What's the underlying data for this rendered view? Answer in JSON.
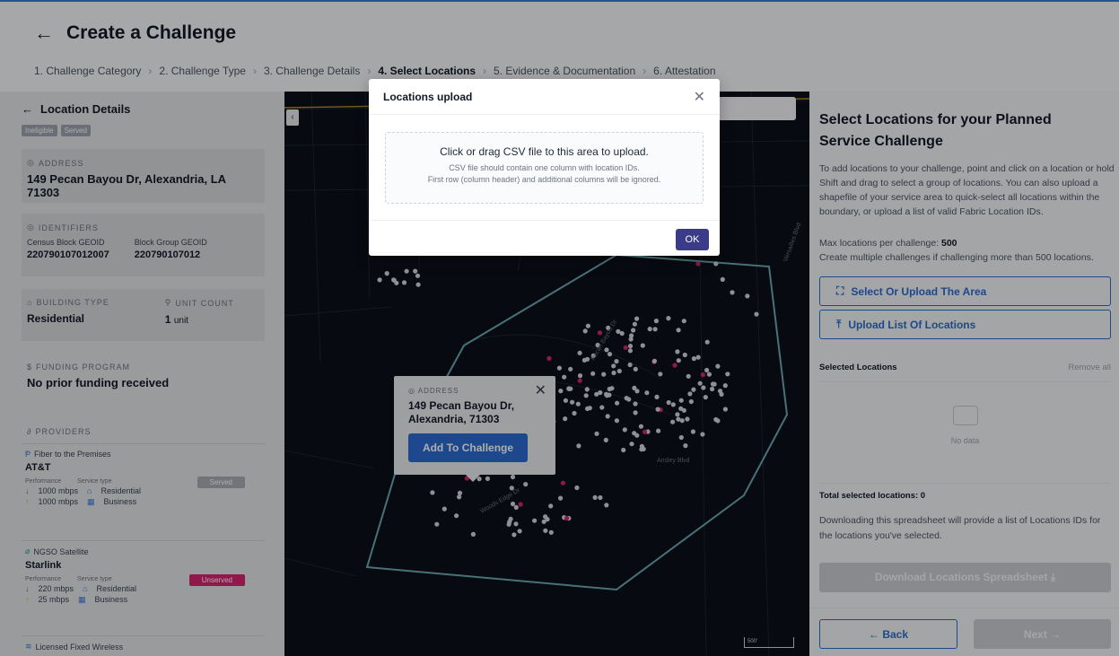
{
  "header": {
    "title": "Create a Challenge",
    "steps": [
      "1. Challenge Category",
      "2. Challenge Type",
      "3. Challenge Details",
      "4. Select Locations",
      "5. Evidence & Documentation",
      "6. Attestation"
    ],
    "active_step": 3
  },
  "left": {
    "title": "Location Details",
    "chips": [
      "Ineligible",
      "Served"
    ],
    "address_label": "ADDRESS",
    "address": "149 Pecan Bayou Dr, Alexandria, LA 71303",
    "identifiers_label": "IDENTIFIERS",
    "census_label": "Census Block GEOID",
    "census_value": "220790107012007",
    "group_label": "Block Group GEOID",
    "group_value": "220790107012",
    "building_label": "BUILDING TYPE",
    "building_value": "Residential",
    "unit_label": "UNIT COUNT",
    "unit_value": "1",
    "unit_suffix": "unit",
    "funding_label": "FUNDING PROGRAM",
    "funding_value": "No prior funding received",
    "providers_label": "PROVIDERS",
    "providers": [
      {
        "tech": "Fiber to the Premises",
        "name": "AT&T",
        "perf_label": "Performance",
        "service_label": "Service type",
        "status": "Served",
        "down": "1000 mbps",
        "up": "1000 mbps",
        "svc1": "Residential",
        "svc2": "Business"
      },
      {
        "tech": "NGSO Satellite",
        "name": "Starlink",
        "perf_label": "Performance",
        "service_label": "Service type",
        "status": "Unserved",
        "down": "220 mbps",
        "up": "25 mbps",
        "svc1": "Residential",
        "svc2": "Business"
      },
      {
        "tech": "Licensed Fixed Wireless"
      }
    ]
  },
  "map": {
    "popup_label": "ADDRESS",
    "popup_line1": "149 Pecan Bayou Dr,",
    "popup_line2": "Alexandria, 71303",
    "popup_button": "Add To Challenge",
    "scale_text": "500'",
    "street_labels": [
      "Ansley Blvd",
      "Woods Edge Dr",
      "Versailles Blvd",
      "Pecan Bayou Dr"
    ]
  },
  "right": {
    "title": "Select Locations for your Planned Service Challenge",
    "description": "To add locations to your challenge, point and click on a location or hold Shift and drag to select a group of locations. You can also upload a shapefile of your service area to quick-select all locations within the boundary, or upload a list of valid Fabric Location IDs.",
    "max_label": "Max locations per challenge:",
    "max_value": "500",
    "max_note": "Create multiple challenges if challenging more than 500 locations.",
    "btn_area": "Select Or Upload The Area",
    "btn_list": "Upload List Of Locations",
    "selected_label": "Selected Locations",
    "remove_all": "Remove all",
    "no_data": "No data",
    "total_label": "Total selected locations: 0",
    "download_note": "Downloading this spreadsheet will provide a list of Locations IDs for the locations you've selected.",
    "download_btn": "Download Locations Spreadsheet",
    "back_btn": "Back",
    "next_btn": "Next"
  },
  "modal": {
    "title": "Locations upload",
    "drop_main": "Click or drag CSV file to this area to upload.",
    "drop_sub1": "CSV file should contain one column with location IDs.",
    "drop_sub2": "First row (column header) and additional columns will be ignored.",
    "ok": "OK"
  },
  "colors": {
    "accent": "#2b6bd1",
    "modal_ok": "#3b3b8a",
    "unserved": "#d6246e",
    "map_bg": "#0b0f19",
    "boundary": "#6aa9b0"
  }
}
